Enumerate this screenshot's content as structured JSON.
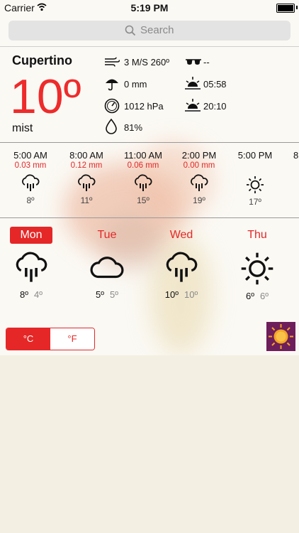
{
  "status_bar": {
    "carrier": "Carrier",
    "time": "5:19 PM"
  },
  "search": {
    "placeholder": "Search"
  },
  "current": {
    "city": "Cupertino",
    "temperature": "10º",
    "condition": "mist",
    "wind": "3 M/S 260º",
    "visibility": "--",
    "precipitation": "0 mm",
    "sunrise": "05:58",
    "pressure": "1012 hPa",
    "sunset": "20:10",
    "humidity": "81%"
  },
  "hourly": [
    {
      "time": "5:00 AM",
      "precip": "0.03 mm",
      "icon": "rain-icon",
      "temp": "8º"
    },
    {
      "time": "8:00 AM",
      "precip": "0.12 mm",
      "icon": "rain-icon",
      "temp": "11º"
    },
    {
      "time": "11:00 AM",
      "precip": "0.06 mm",
      "icon": "rain-icon",
      "temp": "15º"
    },
    {
      "time": "2:00 PM",
      "precip": "0.00 mm",
      "icon": "rain-icon",
      "temp": "19º"
    },
    {
      "time": "5:00 PM",
      "precip": "",
      "icon": "sun-icon",
      "temp": "17º"
    },
    {
      "time": "8",
      "precip": "",
      "icon": "",
      "temp": ""
    }
  ],
  "daily": [
    {
      "day": "Mon",
      "icon": "rain-icon",
      "max": "8º",
      "min": "4º",
      "active": true
    },
    {
      "day": "Tue",
      "icon": "cloud-icon",
      "max": "5º",
      "min": "5º",
      "active": false
    },
    {
      "day": "Wed",
      "icon": "rain-icon",
      "max": "10º",
      "min": "10º",
      "active": false
    },
    {
      "day": "Thu",
      "icon": "sun-icon",
      "max": "6º",
      "min": "6º",
      "active": false
    }
  ],
  "units": {
    "celsius": "°C",
    "fahrenheit": "°F",
    "selected": "celsius"
  },
  "colors": {
    "accent": "#e52727",
    "temperature": "#ee2b2b",
    "logo_bg": "#6e1e5a",
    "logo_sun": "#f5a623"
  }
}
